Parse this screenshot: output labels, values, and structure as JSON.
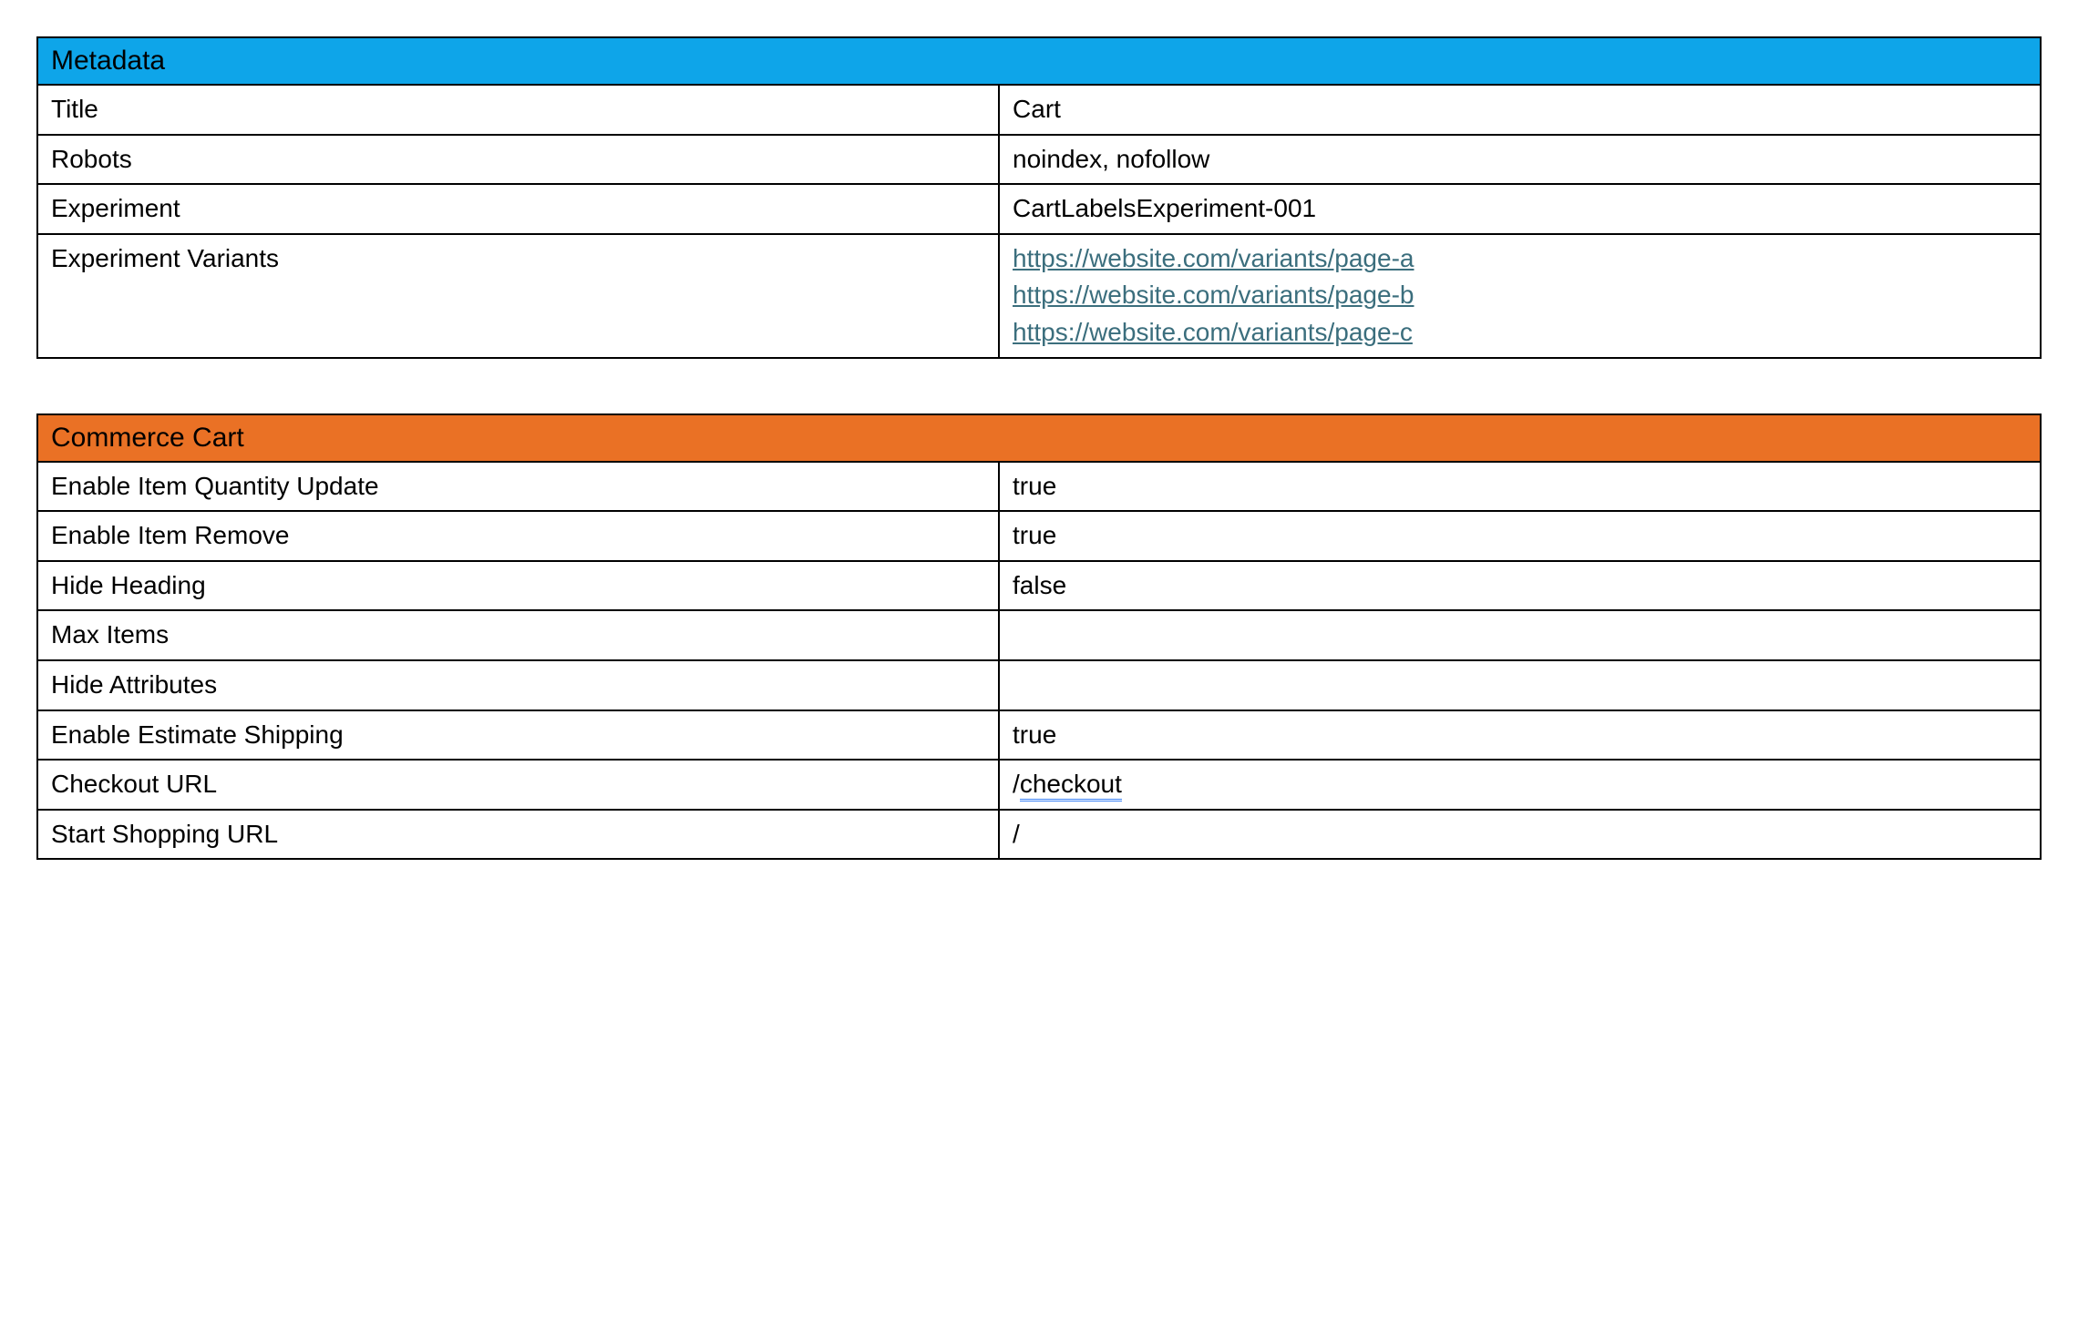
{
  "metadata": {
    "header": "Metadata",
    "rows": {
      "title": {
        "label": "Title",
        "value": "Cart"
      },
      "robots": {
        "label": "Robots",
        "value": "noindex, nofollow"
      },
      "experiment": {
        "label": "Experiment",
        "value": "CartLabelsExperiment-001"
      },
      "experiment_variants": {
        "label": "Experiment Variants",
        "links": [
          "https://website.com/variants/page-a",
          "https://website.com/variants/page-b",
          "https://website.com/variants/page-c"
        ]
      }
    }
  },
  "commerce": {
    "header": "Commerce Cart",
    "rows": {
      "enable_item_quantity_update": {
        "label": "Enable Item Quantity Update",
        "value": "true"
      },
      "enable_item_remove": {
        "label": "Enable Item Remove",
        "value": "true"
      },
      "hide_heading": {
        "label": "Hide Heading",
        "value": "false"
      },
      "max_items": {
        "label": "Max Items",
        "value": ""
      },
      "hide_attributes": {
        "label": "Hide Attributes",
        "value": ""
      },
      "enable_estimate_shipping": {
        "label": "Enable Estimate Shipping",
        "value": "true"
      },
      "checkout_url": {
        "label": "Checkout URL",
        "prefix": "/",
        "path": "checkout"
      },
      "start_shopping_url": {
        "label": "Start Shopping URL",
        "value": "/"
      }
    }
  }
}
